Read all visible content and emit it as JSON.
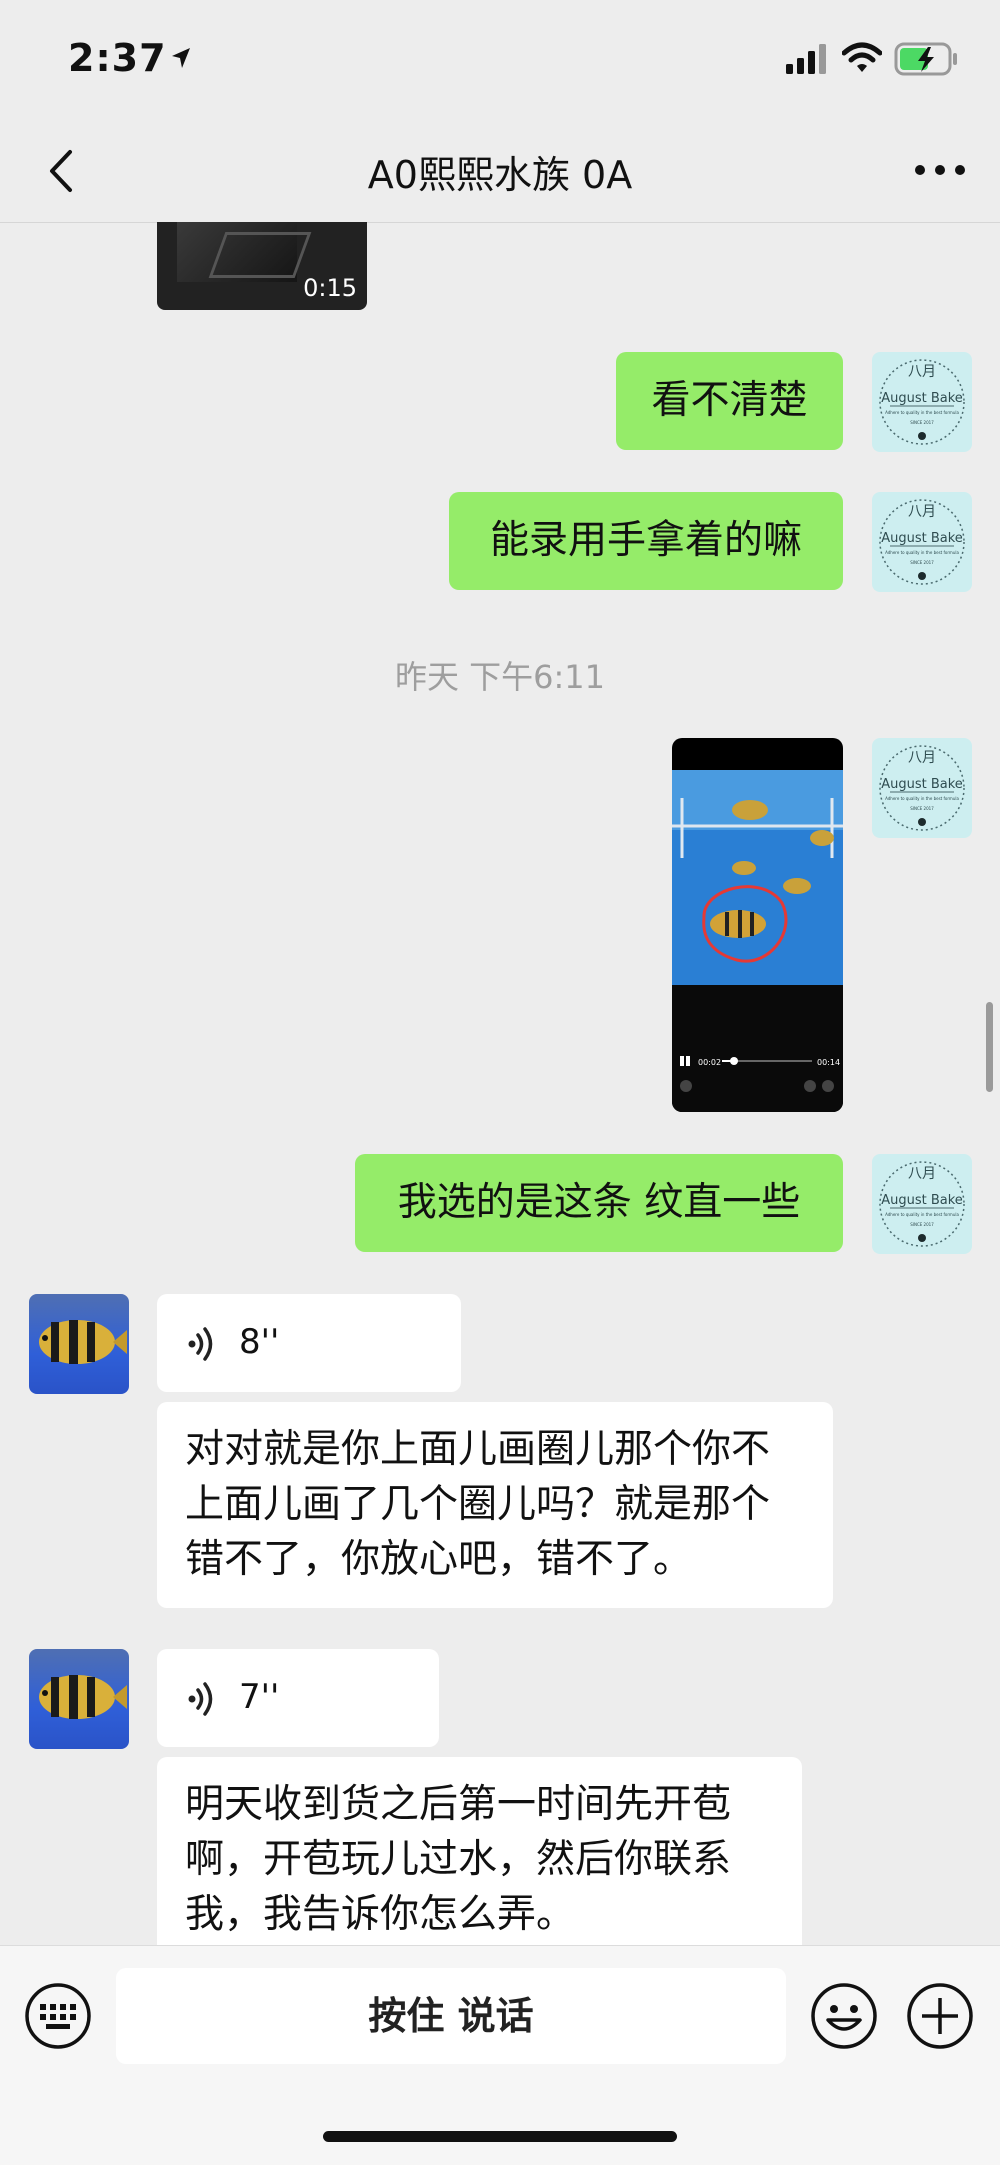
{
  "status": {
    "time": "2:37"
  },
  "nav": {
    "title": "A0熙熙水族 0A"
  },
  "messages": {
    "video_top_duration": "0:15",
    "m1": "看不清楚",
    "m2": "能录用手拿着的嘛",
    "timestamp": "昨天 下午6:11",
    "video_player_current": "00:02",
    "video_player_total": "00:14",
    "m3": "我选的是这条 纹直一些",
    "voice1_duration": "8''",
    "transcript1": "对对就是你上面儿画圈儿那个你不上面儿画了几个圈儿吗？就是那个错不了，你放心吧，错不了。",
    "voice2_duration": "7''",
    "transcript2": "明天收到货之后第一时间先开苞啊，开苞玩儿过水，然后你联系我，我告诉你怎么弄。"
  },
  "avatar_self": {
    "top": "八月",
    "brand": "August Bake",
    "tagline": "Adhere to quality in the best formula",
    "since": "SINCE 2017"
  },
  "input": {
    "hold_to_talk": "按住 说话"
  },
  "colors": {
    "sent_bubble": "#95ec69",
    "received_bubble": "#ffffff",
    "background": "#ededed"
  }
}
